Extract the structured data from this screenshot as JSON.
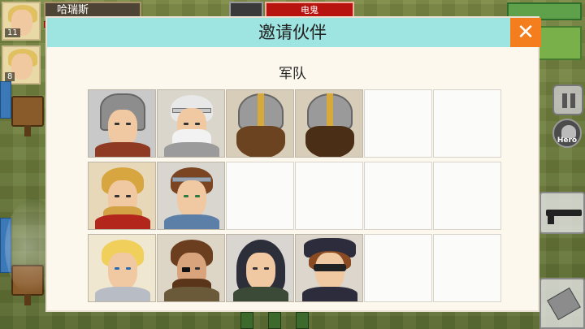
{
  "dialog": {
    "title": "邀请伙伴",
    "close_icon": "close-icon",
    "group_heading": "军队"
  },
  "hud": {
    "player_name": "哈瑞斯",
    "enemy_label": "电鬼",
    "party_levels": [
      "11",
      "8"
    ],
    "hero_label": "Hero",
    "pause_icon": "pause-icon",
    "weapon_icon": "assault-rifle-icon",
    "ammo_icon": "ammo-can-icon"
  },
  "slots": [
    {
      "filled": true,
      "character": "knight-in-hood"
    },
    {
      "filled": true,
      "character": "old-bearded-warrior"
    },
    {
      "filled": true,
      "character": "helmeted-dwarf"
    },
    {
      "filled": true,
      "character": "helmeted-dwarf"
    },
    {
      "filled": false
    },
    {
      "filled": false
    },
    {
      "filled": true,
      "character": "blonde-bearded-swordsman"
    },
    {
      "filled": true,
      "character": "brown-haired-knight"
    },
    {
      "filled": false
    },
    {
      "filled": false
    },
    {
      "filled": false
    },
    {
      "filled": false
    },
    {
      "filled": true,
      "character": "blonde-youth"
    },
    {
      "filled": true,
      "character": "eyepatch-mercenary"
    },
    {
      "filled": true,
      "character": "long-black-haired-swordsman"
    },
    {
      "filled": true,
      "character": "masked-bandit"
    },
    {
      "filled": false
    },
    {
      "filled": false
    }
  ],
  "colors": {
    "header": "#9ee4e1",
    "close_button": "#f47e1d",
    "dialog_bg": "#fdf8ee"
  }
}
